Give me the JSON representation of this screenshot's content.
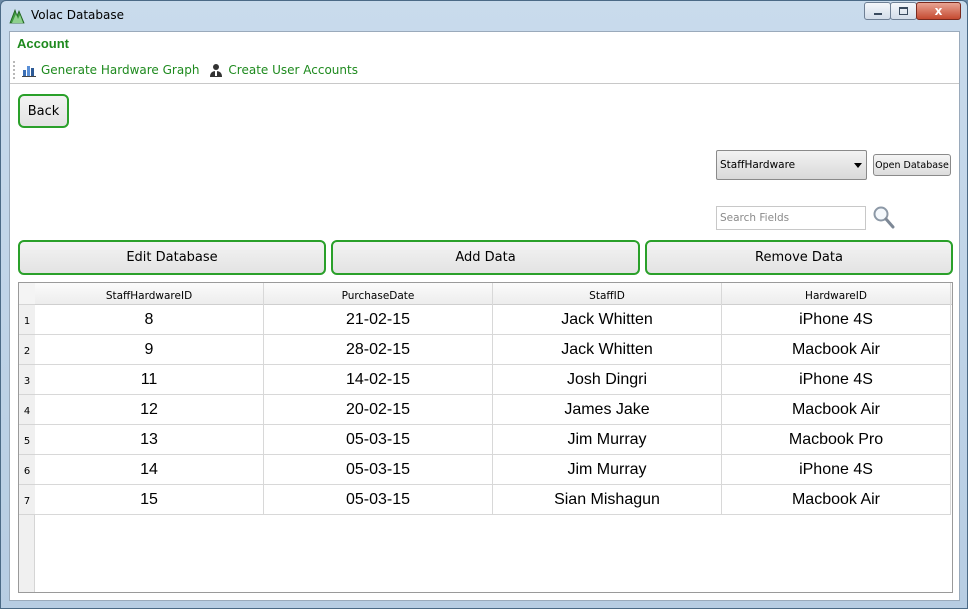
{
  "window": {
    "title": "Volac Database",
    "close_label": "x"
  },
  "menu": {
    "section_label": "Account",
    "items": [
      {
        "label": "Generate Hardware Graph",
        "icon": "bar-chart-icon"
      },
      {
        "label": "Create User Accounts",
        "icon": "user-icon"
      }
    ]
  },
  "buttons": {
    "back": "Back",
    "edit": "Edit Database",
    "add": "Add Data",
    "remove": "Remove Data",
    "open_database": "Open Database"
  },
  "table_select": {
    "selected": "StaffHardware"
  },
  "search": {
    "placeholder": "Search Fields",
    "value": ""
  },
  "colors": {
    "accent_green": "#2aa02a",
    "label_green": "#1e8a1e"
  },
  "grid": {
    "columns": [
      "StaffHardwareID",
      "PurchaseDate",
      "StaffID",
      "HardwareID"
    ],
    "rows": [
      {
        "num": "1",
        "cells": [
          "8",
          "21-02-15",
          "Jack Whitten",
          "iPhone 4S"
        ]
      },
      {
        "num": "2",
        "cells": [
          "9",
          "28-02-15",
          "Jack Whitten",
          "Macbook Air"
        ]
      },
      {
        "num": "3",
        "cells": [
          "11",
          "14-02-15",
          "Josh Dingri",
          "iPhone 4S"
        ]
      },
      {
        "num": "4",
        "cells": [
          "12",
          "20-02-15",
          "James Jake",
          "Macbook Air"
        ]
      },
      {
        "num": "5",
        "cells": [
          "13",
          "05-03-15",
          "Jim Murray",
          "Macbook Pro"
        ]
      },
      {
        "num": "6",
        "cells": [
          "14",
          "05-03-15",
          "Jim Murray",
          "iPhone 4S"
        ]
      },
      {
        "num": "7",
        "cells": [
          "15",
          "05-03-15",
          "Sian Mishagun",
          "Macbook Air"
        ]
      }
    ]
  }
}
